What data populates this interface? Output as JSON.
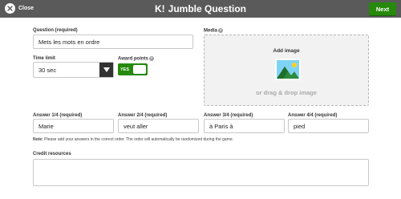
{
  "header": {
    "close_label": "Close",
    "logo": "K!",
    "title": "Jumble Question",
    "next_label": "Next"
  },
  "question": {
    "label": "Question (required)",
    "value": "Mets les mots en ordre"
  },
  "time_limit": {
    "label": "Time limit",
    "value": "30 sec"
  },
  "award_points": {
    "label": "Award points",
    "toggle_text": "YES",
    "enabled": true
  },
  "media": {
    "label": "Media",
    "add_image": "Add image",
    "drag_text": "or drag & drop image"
  },
  "answers": [
    {
      "label": "Answer 1/4 (required)",
      "value": "Marie"
    },
    {
      "label": "Answer 2/4 (required)",
      "value": "veut aller"
    },
    {
      "label": "Answer 3/4 (required)",
      "value": "à Paris à"
    },
    {
      "label": "Answer 4/4 (required)",
      "value": "pied"
    }
  ],
  "note": {
    "prefix": "Note:",
    "text": " Please add your answers in the correct order. The order will automatically be randomized during the game."
  },
  "credit": {
    "label": "Credit resources",
    "value": ""
  },
  "colors": {
    "topbar": "#5a5a5a",
    "accent_green": "#26890c",
    "media_bg": "#f2f2f2"
  }
}
